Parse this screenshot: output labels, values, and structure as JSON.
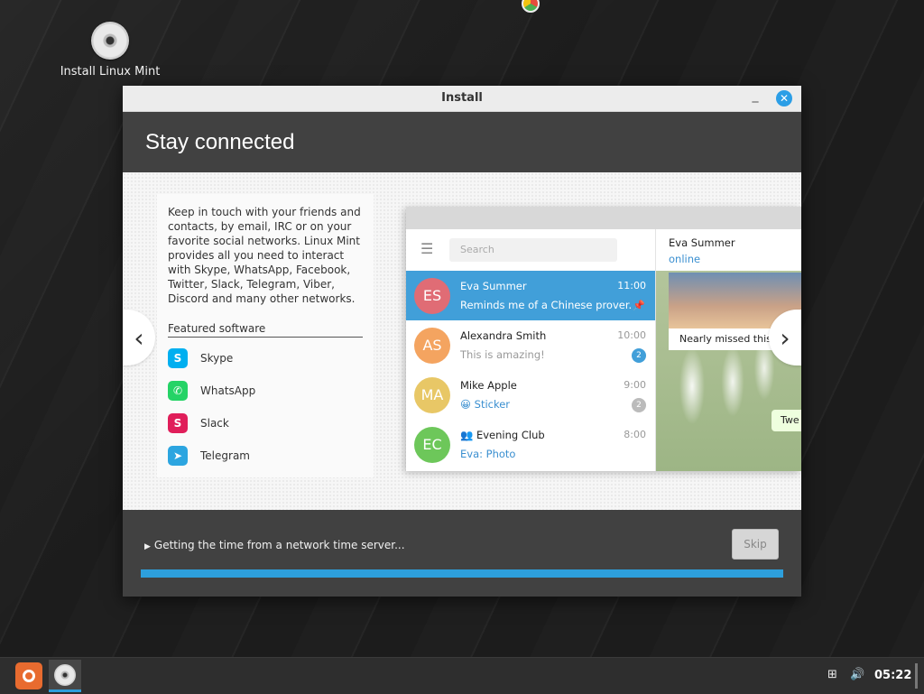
{
  "desktop": {
    "icon_label": "Install Linux Mint"
  },
  "window": {
    "title": "Install",
    "minimize_glyph": "_",
    "close_glyph": "✕"
  },
  "header": {
    "title": "Stay connected"
  },
  "description": "Keep in touch with your friends and contacts, by email, IRC or on your favorite social networks. Linux Mint provides all you need to interact with Skype, WhatsApp, Facebook, Twitter, Slack, Telegram, Viber, Discord and many other networks.",
  "featured": {
    "heading": "Featured software",
    "apps": [
      {
        "label": "Skype",
        "icon": "skype-icon",
        "color": "#00aff0",
        "glyph": "S"
      },
      {
        "label": "WhatsApp",
        "icon": "whatsapp-icon",
        "color": "#25d366",
        "glyph": "✆"
      },
      {
        "label": "Slack",
        "icon": "slack-icon",
        "color": "#e01e5a",
        "glyph": "S"
      },
      {
        "label": "Telegram",
        "icon": "telegram-icon",
        "color": "#2ca5e0",
        "glyph": "➤"
      }
    ]
  },
  "nav": {
    "prev_glyph": "‹",
    "next_glyph": "›"
  },
  "telegram": {
    "search_placeholder": "Search",
    "chats": [
      {
        "initials": "ES",
        "name": "Eva Summer",
        "time": "11:00",
        "message": "Reminds me of a Chinese prover...",
        "color": "#e06c75",
        "selected": true,
        "badge": "📌"
      },
      {
        "initials": "AS",
        "name": "Alexandra Smith",
        "time": "10:00",
        "message": "This is amazing!",
        "color": "#f4a460",
        "badge": "2",
        "badge_color": "#419fd9"
      },
      {
        "initials": "MA",
        "name": "Mike Apple",
        "time": "9:00",
        "message": "😀 Sticker",
        "color": "#e8c766",
        "badge": "2",
        "badge_color": "#bbbbbb",
        "msg_blue": true
      },
      {
        "initials": "EC",
        "name": "Evening Club",
        "time": "8:00",
        "message": "Eva: Photo",
        "color": "#6dc75a",
        "msg_blue": true,
        "group": true
      }
    ],
    "conversation": {
      "name": "Eva Summer",
      "status": "online",
      "caption": "Nearly missed this s",
      "bubble": "Twe"
    }
  },
  "footer": {
    "status": "Getting the time from a network time server...",
    "skip_label": "Skip",
    "progress": 1.0,
    "accent": "#2d9fdc"
  },
  "taskbar": {
    "clock": "05:22"
  }
}
